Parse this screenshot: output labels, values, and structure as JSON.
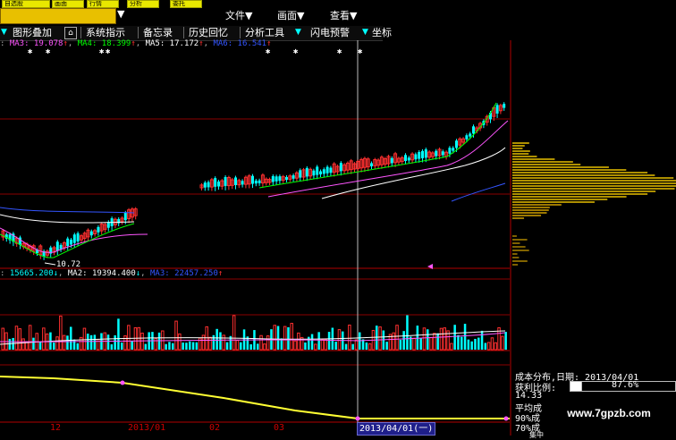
{
  "top_buttons": [
    "自选股",
    "画面",
    "行情",
    "分析",
    "委托"
  ],
  "menus": {
    "file": "文件",
    "screen": "画面",
    "view": "查看"
  },
  "toolbar": {
    "overlay": "图形叠加",
    "indicators": "系统指示",
    "memo": "备忘录",
    "history": "历史回忆",
    "analysis": "分析工具",
    "flash": "闪电预警",
    "coord": "坐标"
  },
  "price_ma": [
    {
      "label": "MA3: 19.078",
      "color": "#ff55ff"
    },
    {
      "label": "MA4: 18.399",
      "color": "#00ff00"
    },
    {
      "label": "MA5: 17.172",
      "color": "#ffffff"
    },
    {
      "label": "MA6: 16.541",
      "color": "#3355ff"
    }
  ],
  "price_low_label": "10.72",
  "vol_ma": [
    {
      "label": "15665.200",
      "color": "#00ffff"
    },
    {
      "label": "MA2: 19394.400",
      "color": "#ffffff"
    },
    {
      "label": "MA3: 22457.250",
      "color": "#3355ff"
    }
  ],
  "date_axis": [
    "12",
    "2013/01",
    "02",
    "03"
  ],
  "cursor_date": "2013/04/01(一)",
  "cost_panel": {
    "title": "成本分布,日期: 2013/04/01",
    "profit_label": "获利比例:",
    "profit_value": "87.6%",
    "price": "14.33",
    "avg": "平均成",
    "r90": "90%成",
    "r70": "70%成",
    "other": "集中"
  },
  "watermark": "www.7gpzb.com",
  "colors": {
    "up": "#ff3030",
    "down": "#00ffff",
    "grid": "#8b0000",
    "accent": "#e8e800"
  }
}
